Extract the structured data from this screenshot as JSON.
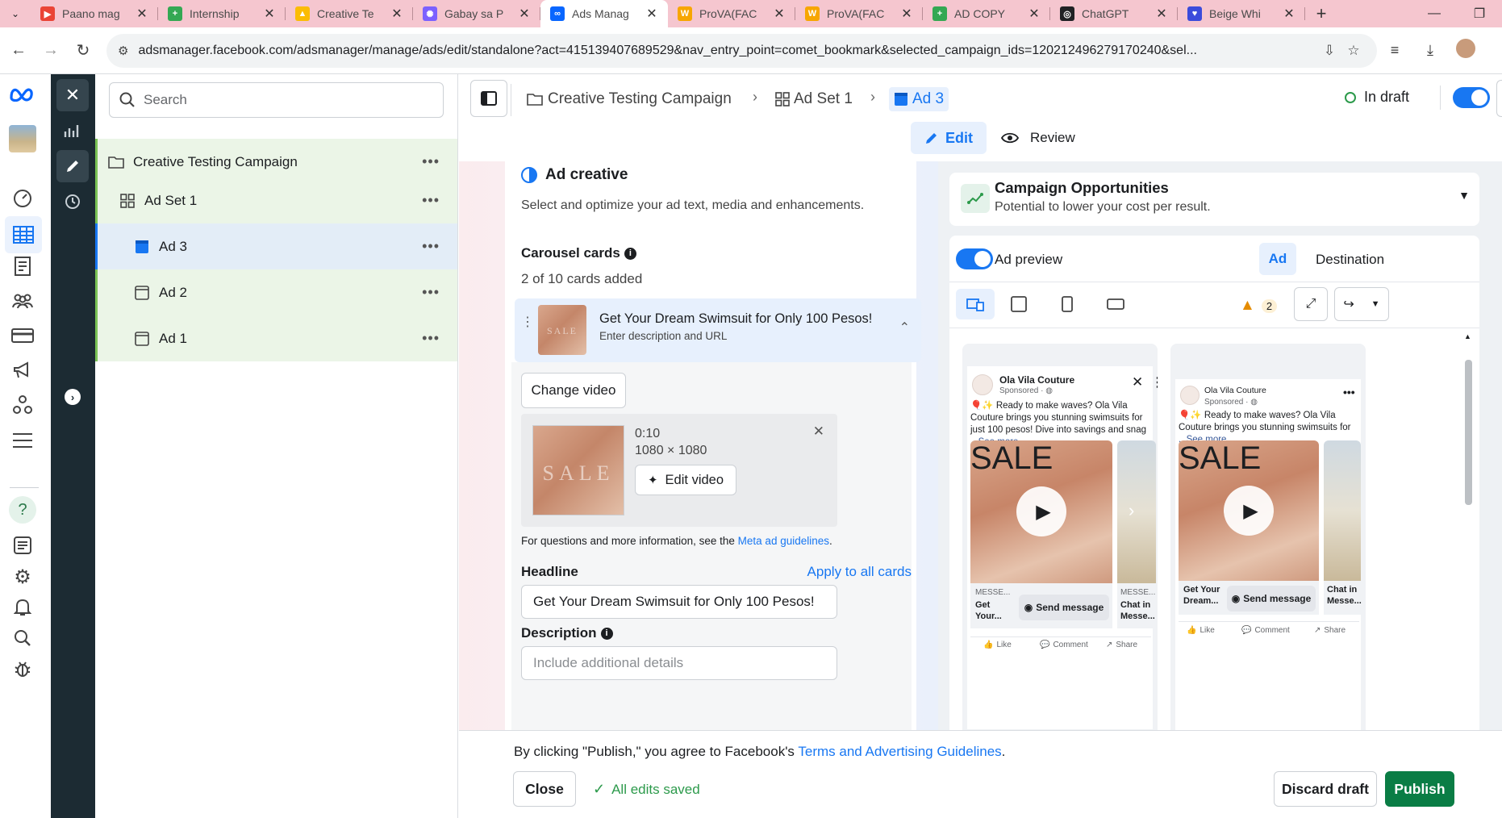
{
  "browser": {
    "tabs": [
      {
        "title": "Paano mag",
        "color": "#ea4335",
        "glyph": "▶"
      },
      {
        "title": "Internship",
        "color": "#34a853",
        "glyph": "+"
      },
      {
        "title": "Creative Te",
        "color": "#fbbc04",
        "glyph": "▲"
      },
      {
        "title": "Gabay sa P",
        "color": "#7b61ff",
        "glyph": "✺"
      },
      {
        "title": "Ads Manag",
        "color": "#0866ff",
        "glyph": "∞",
        "active": true
      },
      {
        "title": "ProVA(FAC",
        "color": "#f7a600",
        "glyph": "W"
      },
      {
        "title": "ProVA(FAC",
        "color": "#f7a600",
        "glyph": "W"
      },
      {
        "title": "AD COPY",
        "color": "#34a853",
        "glyph": "+"
      },
      {
        "title": "ChatGPT",
        "color": "#202124",
        "glyph": "◎"
      },
      {
        "title": "Beige Whi",
        "color": "#3b4bdb",
        "glyph": "♥"
      }
    ],
    "url": "adsmanager.facebook.com/adsmanager/manage/ads/edit/standalone?act=415139407689529&nav_entry_point=comet_bookmark&selected_campaign_ids=120212496279170240&sel..."
  },
  "tree": {
    "search_placeholder": "Search",
    "items": [
      {
        "label": "Creative Testing Campaign",
        "kind": "campaign"
      },
      {
        "label": "Ad Set 1",
        "kind": "adset"
      },
      {
        "label": "Ad 3",
        "kind": "ad",
        "selected": true
      },
      {
        "label": "Ad 2",
        "kind": "ad"
      },
      {
        "label": "Ad 1",
        "kind": "ad"
      }
    ],
    "more": "•••"
  },
  "header": {
    "crumb_campaign": "Creative Testing Campaign",
    "crumb_adset": "Ad Set 1",
    "crumb_ad": "Ad 3",
    "status": "In draft",
    "edit": "Edit",
    "review": "Review"
  },
  "form": {
    "section_title": "Ad creative",
    "section_desc": "Select and optimize your ad text, media and enhancements.",
    "carousel_title": "Carousel cards",
    "carousel_count": "2 of 10 cards added",
    "card_title": "Get Your Dream Swimsuit for Only 100 Pesos!",
    "card_sub": "Enter description and URL",
    "change_video": "Change video",
    "video_duration": "0:10",
    "video_dims": "1080 × 1080",
    "edit_video": "Edit video",
    "guidelines_prefix": "For questions and more information, see the",
    "guidelines_link": "Meta ad guidelines",
    "guidelines_suffix": ".",
    "headline_label": "Headline",
    "apply_all": "Apply to all cards",
    "headline_value": "Get Your Dream Swimsuit for Only 100 Pesos!",
    "description_label": "Description",
    "description_placeholder": "Include additional details",
    "thumb_text": "SALE"
  },
  "preview": {
    "opp_title": "Campaign Opportunities",
    "opp_sub": "Potential to lower your cost per result.",
    "ad_preview": "Ad preview",
    "tab_ad": "Ad",
    "tab_destination": "Destination",
    "warning_count": "2",
    "page_name": "Ola Vila Couture",
    "sponsored": "Sponsored · ",
    "post1_text": "🎈✨ Ready to make waves? Ola Vila Couture brings you stunning swimsuits for just 100 pesos! Dive into savings and snag",
    "post2_text": "🎈✨ Ready to make waves? Ola Vila Couture brings you stunning swimsuits for",
    "see_more": "...See more",
    "cta_small": "MESSE...",
    "cta_head1": "Get Your...",
    "cta_head2": "Get Your Dream...",
    "chat_small": "MESSE...",
    "chat_head": "Chat in Messe...",
    "send_message": "Send message",
    "like": "Like",
    "comment": "Comment",
    "share": "Share"
  },
  "footer": {
    "agree_prefix": "By clicking \"Publish,\" you agree to Facebook's",
    "agree_link": "Terms and Advertising Guidelines",
    "agree_suffix": ".",
    "close": "Close",
    "saved": "All edits saved",
    "discard": "Discard draft",
    "publish": "Publish"
  },
  "colors": {
    "accent": "#1877f2",
    "publish": "#0a7d45",
    "rail_dark": "#1c2b33",
    "tree_green": "#ebf5e7"
  }
}
